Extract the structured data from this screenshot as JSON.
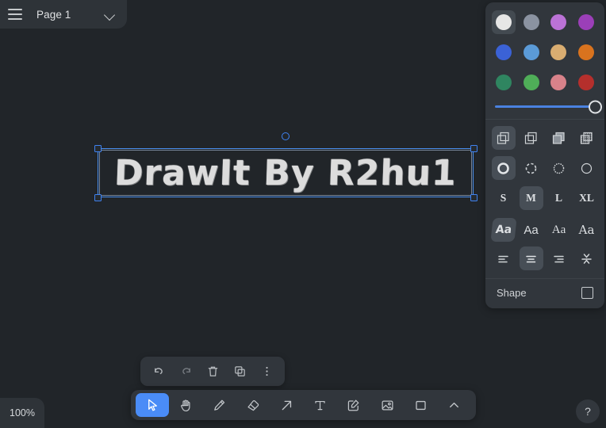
{
  "app": {
    "canvas_background": "#212529",
    "panel_background": "#31363c",
    "accent": "#4a8cf7"
  },
  "page_bar": {
    "menu_icon": "hamburger-icon",
    "page_name": "Page 1",
    "chevron_icon": "chevron-down-icon"
  },
  "canvas": {
    "text_element": {
      "content": "DrawIt By R2hu1",
      "color": "#dcdcdc",
      "selected": true,
      "rotation_handle": "rotate-handle"
    }
  },
  "properties_panel": {
    "colors": [
      {
        "name": "white",
        "hex": "#e6e6e6",
        "selected": true
      },
      {
        "name": "gray",
        "hex": "#8b93a1",
        "selected": false
      },
      {
        "name": "orchid",
        "hex": "#bb72d6",
        "selected": false
      },
      {
        "name": "purple",
        "hex": "#9b3fb8",
        "selected": false
      },
      {
        "name": "blue",
        "hex": "#3b62d6",
        "selected": false
      },
      {
        "name": "light-blue",
        "hex": "#5b9bd8",
        "selected": false
      },
      {
        "name": "tan",
        "hex": "#d9ad71",
        "selected": false
      },
      {
        "name": "orange",
        "hex": "#d9731e",
        "selected": false
      },
      {
        "name": "dark-green",
        "hex": "#2f8560",
        "selected": false
      },
      {
        "name": "green",
        "hex": "#4fae58",
        "selected": false
      },
      {
        "name": "salmon",
        "hex": "#d8828a",
        "selected": false
      },
      {
        "name": "dark-red",
        "hex": "#b52f2c",
        "selected": false
      }
    ],
    "opacity_slider": {
      "value": 100,
      "fill_color": "#4a82e0"
    },
    "fill_styles": [
      {
        "name": "fill-transparent",
        "selected": true
      },
      {
        "name": "fill-outline",
        "selected": false
      },
      {
        "name": "fill-solid",
        "selected": false
      },
      {
        "name": "fill-hachure",
        "selected": false
      }
    ],
    "stroke_styles": [
      {
        "name": "stroke-solid",
        "selected": true
      },
      {
        "name": "stroke-dashed",
        "selected": false
      },
      {
        "name": "stroke-dotted",
        "selected": false
      },
      {
        "name": "stroke-thin",
        "selected": false
      }
    ],
    "sizes": [
      {
        "label": "S",
        "selected": false
      },
      {
        "label": "M",
        "selected": true
      },
      {
        "label": "L",
        "selected": false
      },
      {
        "label": "XL",
        "selected": false
      }
    ],
    "fonts": [
      {
        "label": "Aa",
        "style": "handwritten",
        "selected": true
      },
      {
        "label": "Aa",
        "style": "sans",
        "selected": false
      },
      {
        "label": "Aa",
        "style": "serif",
        "selected": false
      },
      {
        "label": "Aa",
        "style": "mono",
        "selected": false
      }
    ],
    "alignments": [
      {
        "name": "align-left",
        "selected": false
      },
      {
        "name": "align-center",
        "selected": true
      },
      {
        "name": "align-right",
        "selected": false
      },
      {
        "name": "align-vertical-center",
        "selected": false
      }
    ],
    "shape_row": {
      "label": "Shape",
      "icon": "square-icon"
    }
  },
  "context_toolbar": {
    "buttons": [
      {
        "name": "undo-button",
        "icon": "undo-icon",
        "enabled": true
      },
      {
        "name": "redo-button",
        "icon": "redo-icon",
        "enabled": false
      },
      {
        "name": "delete-button",
        "icon": "trash-icon",
        "enabled": true
      },
      {
        "name": "duplicate-button",
        "icon": "duplicate-icon",
        "enabled": true
      },
      {
        "name": "more-button",
        "icon": "more-vertical-icon",
        "enabled": true
      }
    ]
  },
  "main_toolbar": {
    "tools": [
      {
        "name": "select-tool",
        "icon": "cursor-icon",
        "active": true
      },
      {
        "name": "hand-tool",
        "icon": "hand-icon",
        "active": false
      },
      {
        "name": "pencil-tool",
        "icon": "pencil-icon",
        "active": false
      },
      {
        "name": "eraser-tool",
        "icon": "eraser-icon",
        "active": false
      },
      {
        "name": "arrow-tool",
        "icon": "arrow-icon",
        "active": false
      },
      {
        "name": "text-tool",
        "icon": "text-icon",
        "active": false
      },
      {
        "name": "note-tool",
        "icon": "note-edit-icon",
        "active": false
      },
      {
        "name": "image-tool",
        "icon": "image-icon",
        "active": false
      },
      {
        "name": "rectangle-tool",
        "icon": "rectangle-icon",
        "active": false
      },
      {
        "name": "expand-tools",
        "icon": "chevron-up-icon",
        "active": false
      }
    ]
  },
  "status": {
    "zoom_level": "100%",
    "help_label": "?"
  }
}
